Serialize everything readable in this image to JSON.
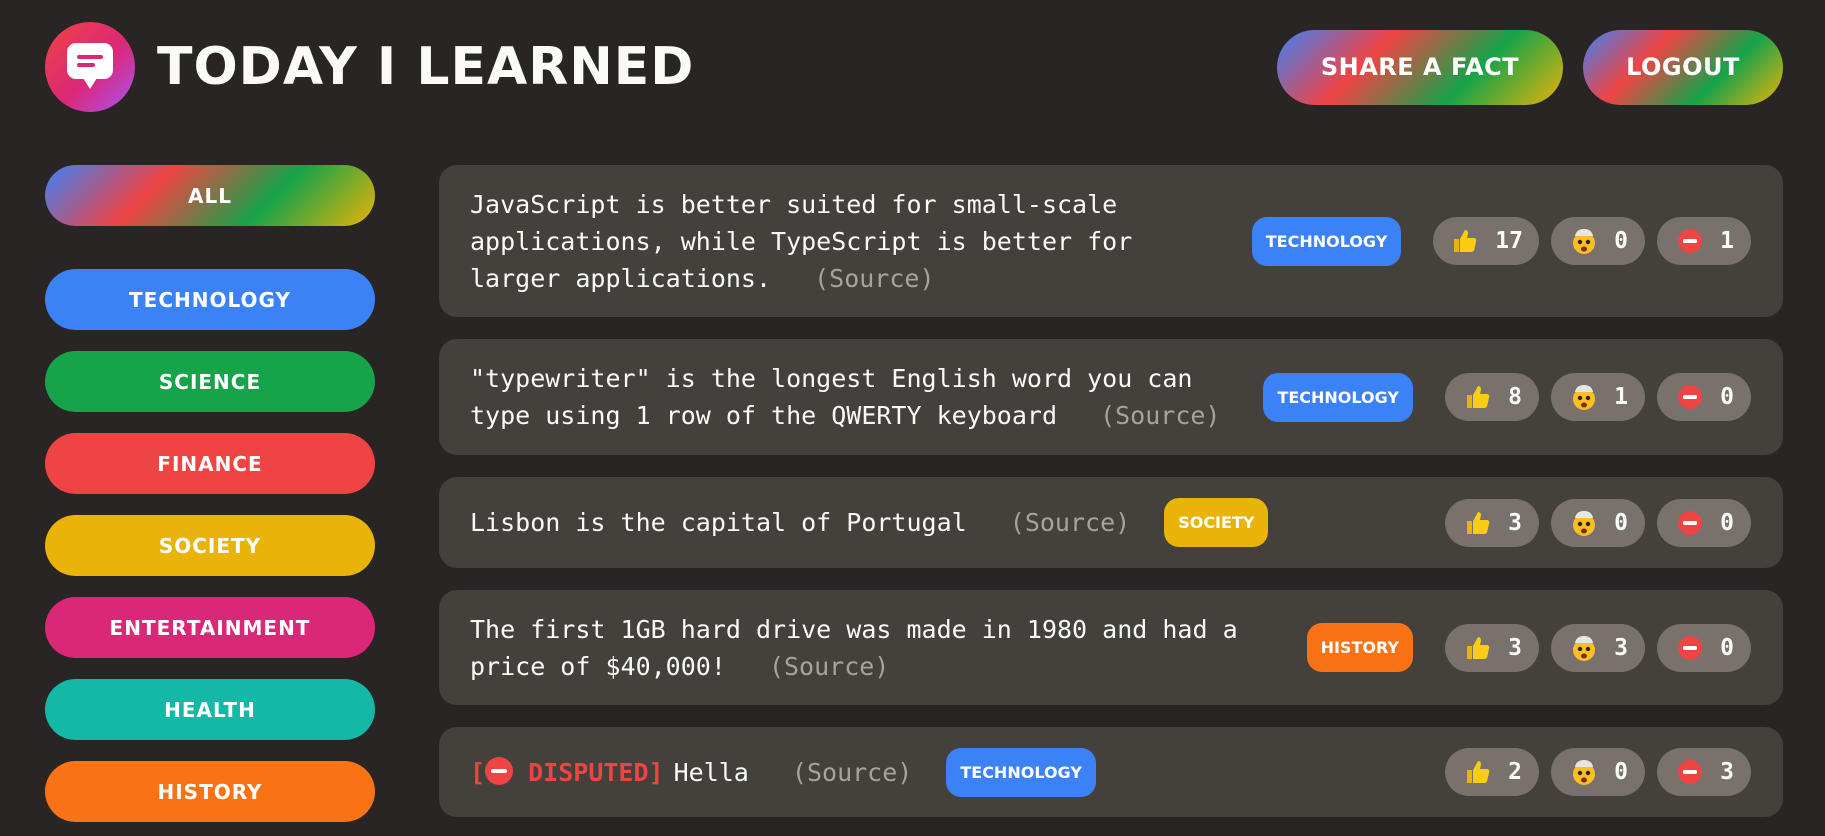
{
  "header": {
    "title": "Today I Learned",
    "share_label": "Share a fact",
    "logout_label": "Logout"
  },
  "sidebar": {
    "items": [
      {
        "label": "All",
        "color": "gradient"
      },
      {
        "label": "Technology",
        "color": "#3b82f6"
      },
      {
        "label": "Science",
        "color": "#16a34a"
      },
      {
        "label": "Finance",
        "color": "#ef4444"
      },
      {
        "label": "Society",
        "color": "#eab308"
      },
      {
        "label": "Entertainment",
        "color": "#db2777"
      },
      {
        "label": "Health",
        "color": "#14b8a6"
      },
      {
        "label": "History",
        "color": "#f97316"
      }
    ]
  },
  "facts": [
    {
      "text": "JavaScript is better suited for small-scale applications, while TypeScript is better for larger applications.",
      "source": "(Source)",
      "category": "Technology",
      "category_color": "#3b82f6",
      "votes": {
        "interesting": "17",
        "mindblowing": "0",
        "false": "1"
      }
    },
    {
      "text": "\"typewriter\" is the longest English word you can type using 1 row of the QWERTY keyboard",
      "source": "(Source)",
      "category": "Technology",
      "category_color": "#3b82f6",
      "votes": {
        "interesting": "8",
        "mindblowing": "1",
        "false": "0"
      }
    },
    {
      "text": "Lisbon is the capital of Portugal",
      "source": "(Source)",
      "category": "Society",
      "category_color": "#eab308",
      "votes": {
        "interesting": "3",
        "mindblowing": "0",
        "false": "0"
      }
    },
    {
      "text": "The first 1GB hard drive was made in 1980 and had a price of $40,000!",
      "source": "(Source)",
      "category": "History",
      "category_color": "#f97316",
      "votes": {
        "interesting": "3",
        "mindblowing": "3",
        "false": "0"
      }
    },
    {
      "disputed_open": "[",
      "disputed_label": "DISPUTED]",
      "text": "Hella",
      "source": "(Source)",
      "category": "Technology",
      "category_color": "#3b82f6",
      "votes": {
        "interesting": "2",
        "mindblowing": "0",
        "false": "3"
      }
    }
  ],
  "icons": {
    "logo": "speech-bubble-icon",
    "interesting": "thumbs-up-icon",
    "mindblowing": "mind-blown-icon",
    "false": "no-entry-icon"
  }
}
